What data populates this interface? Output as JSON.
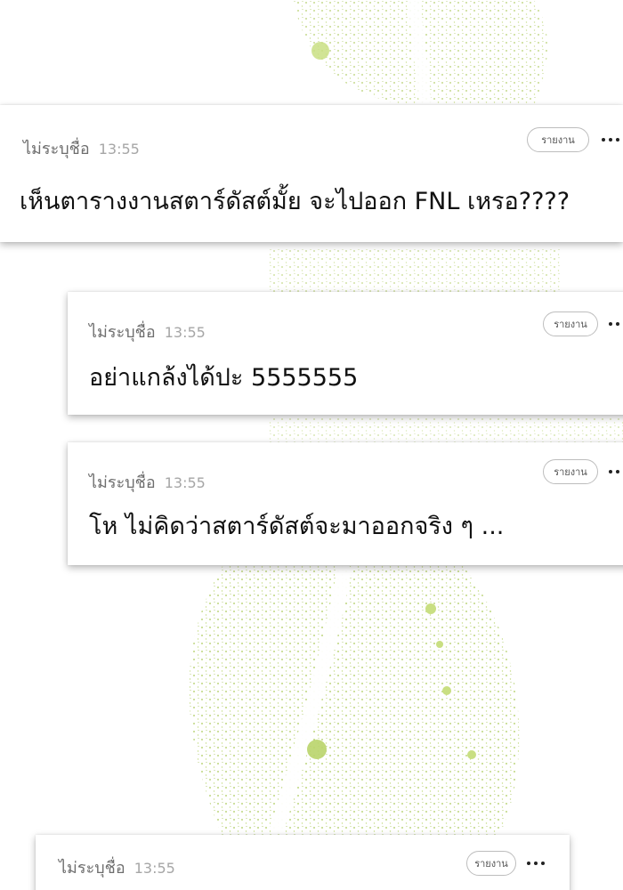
{
  "comments": [
    {
      "author": "ไม่ระบุชื่อ",
      "time": "13:55",
      "report_label": "รายงาน",
      "text": "เห็นตารางงานสตาร์ดัสต์มั้ย จะไปออก FNL เหรอ????"
    },
    {
      "author": "ไม่ระบุชื่อ",
      "time": "13:55",
      "report_label": "รายงาน",
      "text": "อย่าแกล้งได้ปะ 5555555"
    },
    {
      "author": "ไม่ระบุชื่อ",
      "time": "13:55",
      "report_label": "รายงาน",
      "text": "โห ไม่คิดว่าสตาร์ดัสต์จะมาออกจริง ๆ ..."
    },
    {
      "author": "ไม่ระบุชื่อ",
      "time": "13:55",
      "report_label": "รายงาน",
      "text": ""
    }
  ],
  "colors": {
    "background_art": "#a8c84a",
    "text": "#111111",
    "meta": "#7a7a7a"
  },
  "icons": [
    "more-dots-icon"
  ]
}
